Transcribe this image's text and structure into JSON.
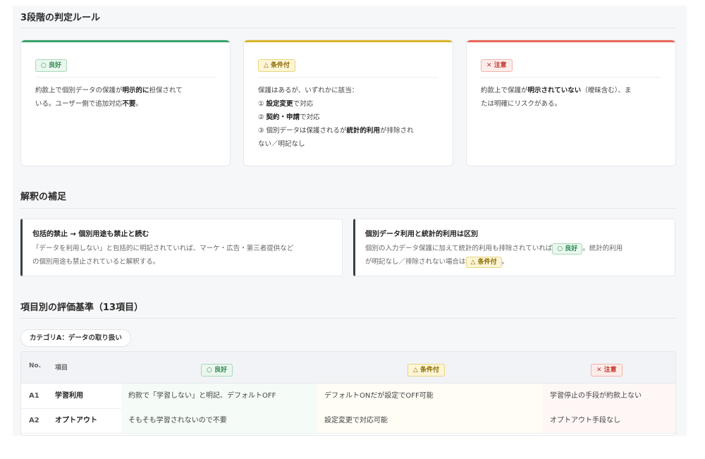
{
  "rules_section": {
    "title": "3段階の判定ルール",
    "cards": [
      {
        "badge": "○ 良好",
        "color": "#3aa26a",
        "lines": [
          [
            {
              "t": "約款上で個別データの保護が"
            },
            {
              "t": "明示的に",
              "b": true
            },
            {
              "t": "担保されて"
            }
          ],
          [
            {
              "t": "いる。ユーザー側で追加対応"
            },
            {
              "t": "不要",
              "b": true
            },
            {
              "t": "。"
            }
          ]
        ]
      },
      {
        "badge": "△ 条件付",
        "color": "#d9b52a",
        "lines": [
          [
            {
              "t": "保護はあるが、いずれかに該当："
            }
          ],
          [
            {
              "t": "① "
            },
            {
              "t": "設定変更",
              "b": true
            },
            {
              "t": "で対応"
            }
          ],
          [
            {
              "t": "② "
            },
            {
              "t": "契約・申請",
              "b": true
            },
            {
              "t": "で対応"
            }
          ],
          [
            {
              "t": "③ 個別データは保護されるが"
            },
            {
              "t": "統計的利用",
              "b": true
            },
            {
              "t": "が排除され"
            }
          ],
          [
            {
              "t": "ない／明記なし"
            }
          ]
        ]
      },
      {
        "badge": "✕ 注意",
        "color": "#e8675a",
        "lines": [
          [
            {
              "t": "約款上で保護が"
            },
            {
              "t": "明示されていない",
              "b": true
            },
            {
              "t": "（曖昧含む）、ま"
            }
          ],
          [
            {
              "t": "たは明確にリスクがある。"
            }
          ]
        ]
      }
    ]
  },
  "supplement_section": {
    "title": "解釈の補足",
    "note1": {
      "title": "包括的禁止 → 個別用途も禁止と読む",
      "line1": "「データを利用しない」と包括的に明記されていれば、マーケ・広告・第三者提供など",
      "line2": "の個別用途も禁止されていると解釈する。"
    },
    "note2": {
      "title": "個別データ利用と統計的利用は区別",
      "line1_pre": "個別の入力データ保護に加えて統計的利用も排除されていれば",
      "line1_badge": "○ 良好",
      "line1_post": "。統計的利用",
      "line2_pre": "が明記なし／排除されない場合は",
      "line2_badge": "△ 条件付",
      "line2_post": "。"
    }
  },
  "criteria_section": {
    "title": "項目別の評価基準（13項目）",
    "category": "カテゴリA：データの取り扱い",
    "table": {
      "headers": {
        "no": "No.",
        "item": "項目",
        "good": "○ 良好",
        "cond": "△ 条件付",
        "warn": "✕ 注意"
      },
      "rows": [
        {
          "no": "A1",
          "item": "学習利用",
          "good": "約款で「学習しない」と明記、デフォルトOFF",
          "cond": "デフォルトONだが設定でOFF可能",
          "warn": "学習停止の手段が約款上ない"
        },
        {
          "no": "A2",
          "item": "オプトアウト",
          "good": "そもそも学習されないので不要",
          "cond": "設定変更で対応可能",
          "warn": "オプトアウト手段なし"
        }
      ]
    }
  }
}
